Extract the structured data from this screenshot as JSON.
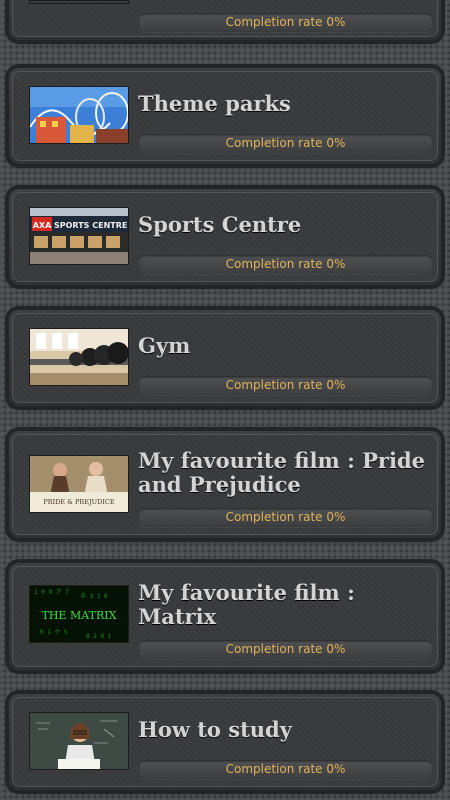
{
  "completion_label": "Completion rate 0%",
  "items": [
    {
      "title": "",
      "thumb_icon": "partial-image-icon"
    },
    {
      "title": "Theme parks",
      "thumb_icon": "rollercoaster-image"
    },
    {
      "title": "Sports Centre",
      "thumb_icon": "sports-centre-image"
    },
    {
      "title": "Gym",
      "thumb_icon": "gym-image"
    },
    {
      "title": "My favourite film : Pride and Prejudice",
      "thumb_icon": "pride-prejudice-poster"
    },
    {
      "title": "My favourite film : Matrix",
      "thumb_icon": "matrix-poster"
    },
    {
      "title": "How to study",
      "thumb_icon": "study-image"
    }
  ],
  "thumb_text": {
    "sports": "SPORTS CENTRE",
    "pride": "PRIDE & PREJUDICE",
    "matrix": "THE MATRIX"
  },
  "colors": {
    "completion_text": "#e2b35a",
    "title_text": "#d4d4d4",
    "matrix_green": "#3fe03f"
  }
}
